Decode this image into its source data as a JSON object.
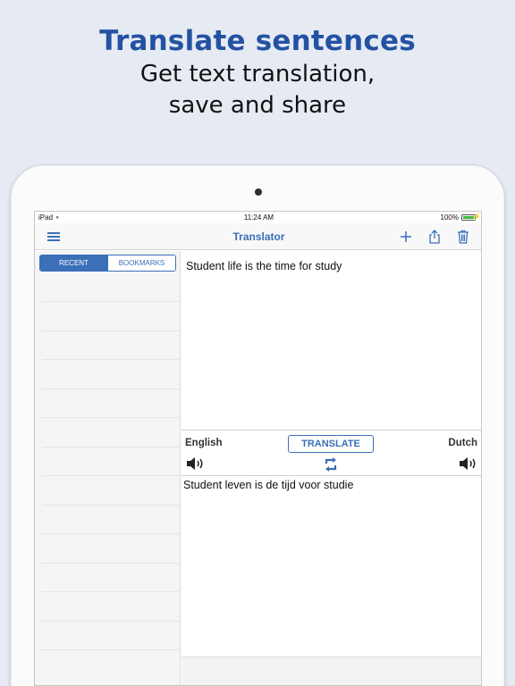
{
  "promo": {
    "headline": "Translate sentences",
    "subline1": "Get text translation,",
    "subline2": "save and share"
  },
  "statusbar": {
    "carrier": "iPad",
    "time": "11:24 AM",
    "battery": "100%",
    "battery_level": 1.0
  },
  "navbar": {
    "title": "Translator",
    "icons": [
      "menu-icon",
      "add-icon",
      "share-icon",
      "trash-icon"
    ]
  },
  "sidebar": {
    "segments": [
      {
        "label": "RECENT",
        "selected": true
      },
      {
        "label": "BOOKMARKS",
        "selected": false
      }
    ]
  },
  "translator": {
    "source_text": "Student life is the time for study",
    "source_language": "English",
    "target_language": "Dutch",
    "translate_label": "TRANSLATE",
    "target_text": "Student leven is de tijd voor studie"
  },
  "colors": {
    "accent": "#3b6fb7",
    "headline": "#2452a3",
    "background": "#e6eaf3"
  }
}
